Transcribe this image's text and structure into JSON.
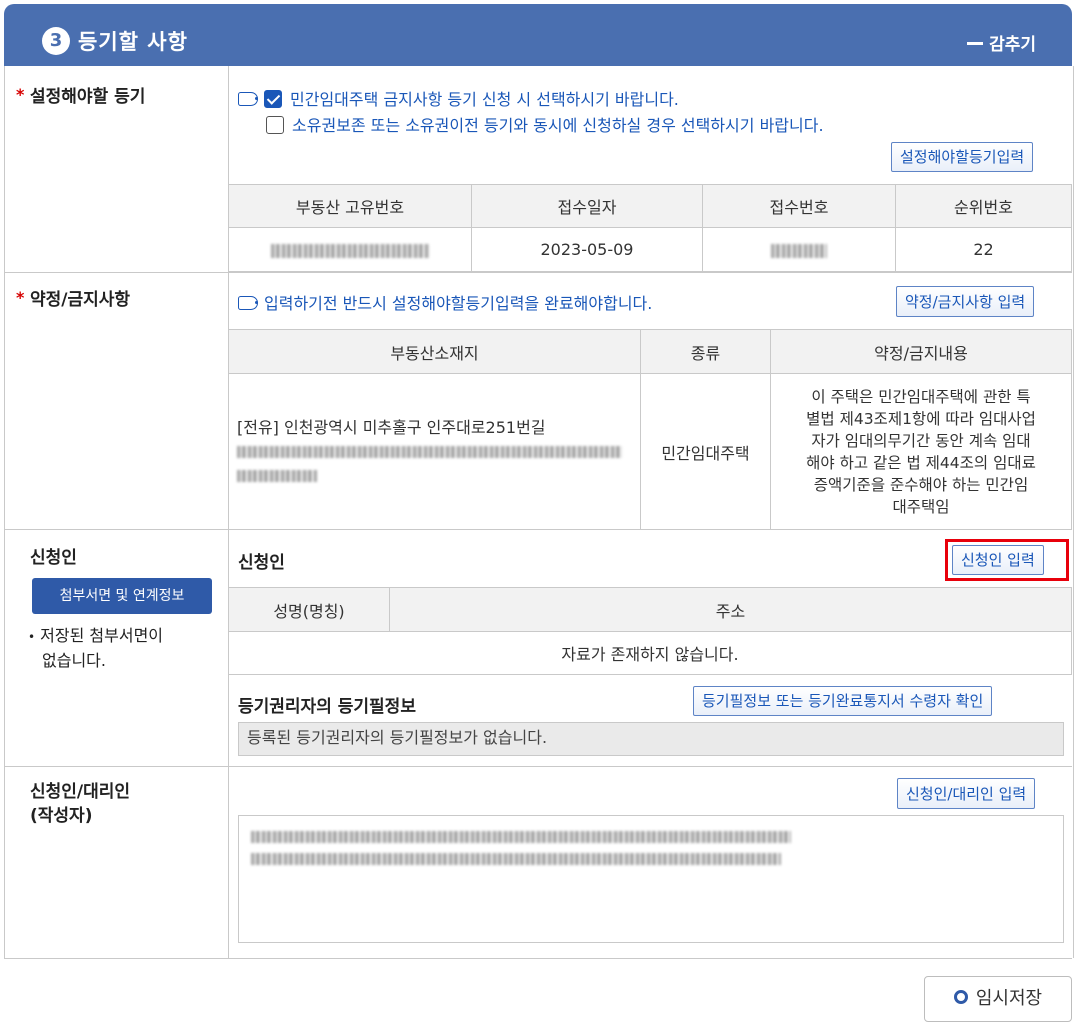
{
  "header": {
    "step_number": "3",
    "title": "등기할 사항",
    "collapse_label": "감추기",
    "colors": {
      "header_bg": "#4a6fb0",
      "link_blue": "#1a57b8",
      "required": "#d60000",
      "highlight": "#e8000b"
    }
  },
  "section_setting": {
    "label": "설정해야할 등기",
    "required_mark": "*",
    "option1": {
      "text": "민간임대주택 금지사항 등기 신청 시 선택하시기 바랍니다.",
      "checked": true
    },
    "option2": {
      "text": "소유권보존 또는 소유권이전 등기와 동시에 신청하실 경우 선택하시기 바랍니다.",
      "checked": false
    },
    "input_button": "설정해야할등기입력",
    "table": {
      "headers": [
        "부동산 고유번호",
        "접수일자",
        "접수번호",
        "순위번호"
      ],
      "row": {
        "receipt_date": "2023-05-09",
        "rank_no": "22"
      }
    }
  },
  "section_covenant": {
    "label": "약정/금지사항",
    "required_mark": "*",
    "info": "입력하기전 반드시 설정해야할등기입력을 완료해야합니다.",
    "input_button": "약정/금지사항 입력",
    "table": {
      "headers": [
        "부동산소재지",
        "종류",
        "약정/금지내용"
      ],
      "location_prefix": "[전유] 인천광역시 미추홀구 인주대로251번길",
      "kind": "민간임대주택",
      "content_lines": [
        "이 주택은 민간임대주택에 관한 특",
        "별법 제43조제1항에 따라 임대사업",
        "자가 임대의무기간 동안 계속 임대",
        "해야 하고 같은 법 제44조의 임대료",
        "증액기준을 준수해야 하는 민간임",
        "대주택임"
      ]
    }
  },
  "section_applicant": {
    "label": "신청인",
    "attach_button": "첨부서면 및 연계정보",
    "note_bullet": "•",
    "note_lines": [
      "저장된 첨부서면이",
      "없습니다."
    ],
    "sub_title": "신청인",
    "input_button": "신청인 입력",
    "table": {
      "headers": [
        "성명(명칭)",
        "주소"
      ],
      "empty_text": "자료가 존재하지 않습니다."
    },
    "rights_title": "등기권리자의 등기필정보",
    "rights_button": "등기필정보 또는 등기완료통지서 수령자 확인",
    "rights_empty": "등록된 등기권리자의 등기필정보가 없습니다."
  },
  "section_agent": {
    "label_lines": [
      "신청인/대리인",
      "(작성자)"
    ],
    "input_button": "신청인/대리인 입력"
  },
  "footer": {
    "save_button": "임시저장"
  }
}
